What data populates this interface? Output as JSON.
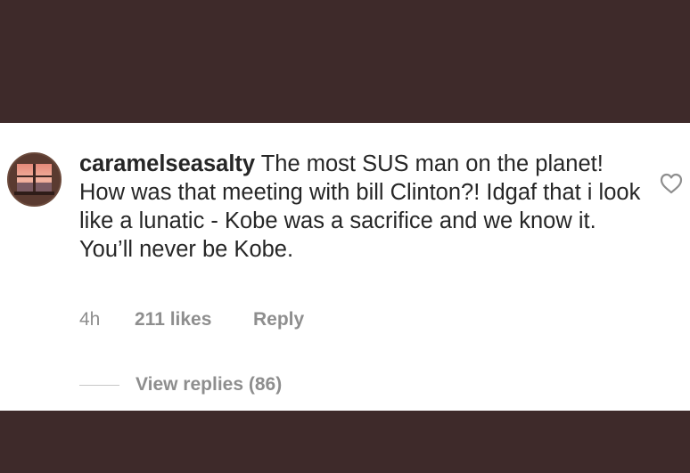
{
  "comment": {
    "username": "caramelseasalty",
    "text": "The most SUS man on the planet! How was that meeting with bill Clinton?! Idgaf that i look like a lunatic - Kobe was a sacrifice and we know it. You’ll never be Kobe.",
    "time": "4h",
    "likes": "211 likes",
    "reply_label": "Reply",
    "view_replies_label": "View replies (86)"
  },
  "icons": {
    "like": "heart-outline-icon",
    "avatar": "sunset-window-avatar"
  },
  "colors": {
    "background_frame": "#3e2a2a",
    "panel": "#ffffff",
    "text_primary": "#262626",
    "text_secondary": "#8e8e8e"
  }
}
